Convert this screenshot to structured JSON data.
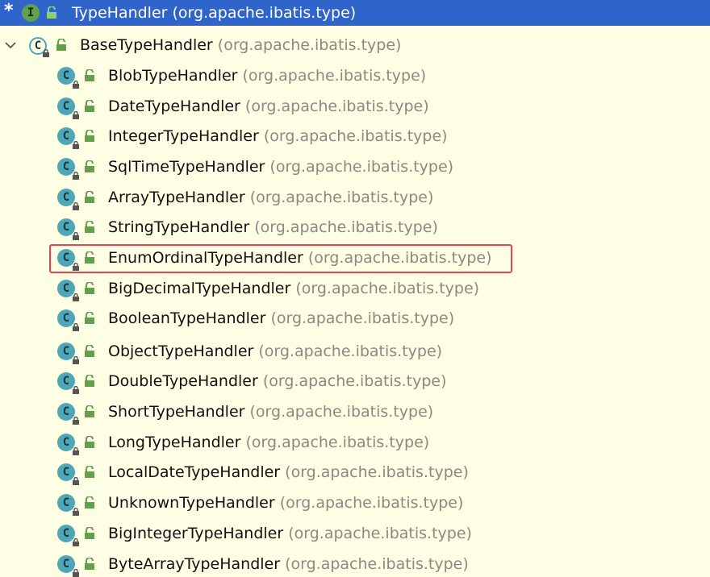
{
  "root": {
    "star": "*",
    "icon_letter": "I",
    "name": "TypeHandler",
    "package": "(org.apache.ibatis.type)"
  },
  "base": {
    "icon_letter": "C",
    "name": "BaseTypeHandler",
    "package": "(org.apache.ibatis.type)"
  },
  "children": [
    {
      "icon_letter": "C",
      "name": "BlobTypeHandler",
      "package": "(org.apache.ibatis.type)"
    },
    {
      "icon_letter": "C",
      "name": "DateTypeHandler",
      "package": "(org.apache.ibatis.type)"
    },
    {
      "icon_letter": "C",
      "name": "IntegerTypeHandler",
      "package": "(org.apache.ibatis.type)"
    },
    {
      "icon_letter": "C",
      "name": "SqlTimeTypeHandler",
      "package": "(org.apache.ibatis.type)"
    },
    {
      "icon_letter": "C",
      "name": "ArrayTypeHandler",
      "package": "(org.apache.ibatis.type)"
    },
    {
      "icon_letter": "C",
      "name": "StringTypeHandler",
      "package": "(org.apache.ibatis.type)"
    },
    {
      "icon_letter": "C",
      "name": "EnumOrdinalTypeHandler",
      "package": "(org.apache.ibatis.type)"
    },
    {
      "icon_letter": "C",
      "name": "BigDecimalTypeHandler",
      "package": "(org.apache.ibatis.type)"
    },
    {
      "icon_letter": "C",
      "name": "BooleanTypeHandler",
      "package": "(org.apache.ibatis.type)"
    },
    {
      "icon_letter": "C",
      "name": "ObjectTypeHandler",
      "package": "(org.apache.ibatis.type)"
    },
    {
      "icon_letter": "C",
      "name": "DoubleTypeHandler",
      "package": "(org.apache.ibatis.type)"
    },
    {
      "icon_letter": "C",
      "name": "ShortTypeHandler",
      "package": "(org.apache.ibatis.type)"
    },
    {
      "icon_letter": "C",
      "name": "LongTypeHandler",
      "package": "(org.apache.ibatis.type)"
    },
    {
      "icon_letter": "C",
      "name": "LocalDateTypeHandler",
      "package": "(org.apache.ibatis.type)"
    },
    {
      "icon_letter": "C",
      "name": "UnknownTypeHandler",
      "package": "(org.apache.ibatis.type)"
    },
    {
      "icon_letter": "C",
      "name": "BigIntegerTypeHandler",
      "package": "(org.apache.ibatis.type)"
    },
    {
      "icon_letter": "C",
      "name": "ByteArrayTypeHandler",
      "package": "(org.apache.ibatis.type)"
    }
  ],
  "colors": {
    "background": "#FEFEE4",
    "selection": "#2F65CA",
    "class_icon": "#4EA7B6",
    "interface_icon": "#62A04E",
    "public_icon": "#62A04E",
    "package_text": "#8A8A80",
    "highlight_border": "#E8434E"
  }
}
